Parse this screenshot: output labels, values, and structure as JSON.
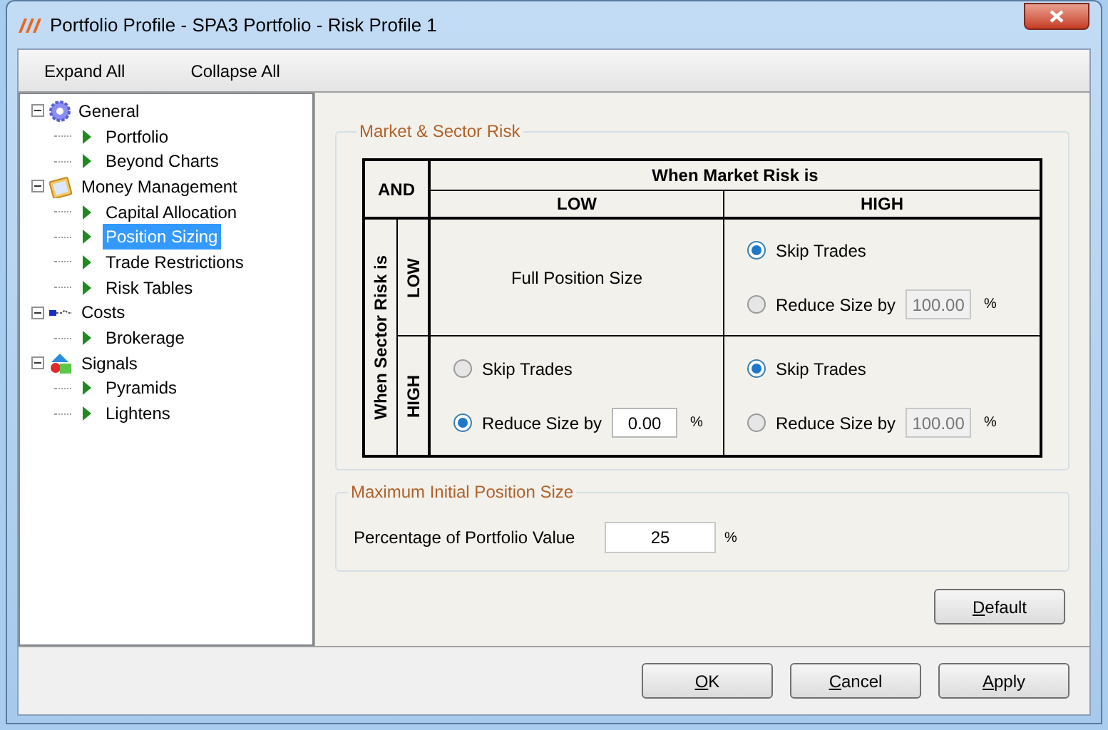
{
  "window": {
    "title": "Portfolio Profile - SPA3 Portfolio - Risk Profile 1"
  },
  "toolbar": [
    {
      "label": "Expand All"
    },
    {
      "label": "Collapse All"
    }
  ],
  "tree": [
    {
      "label": "General",
      "kind": "gear",
      "expanded": true,
      "selected": false,
      "children": [
        {
          "label": "Portfolio",
          "selected": false
        },
        {
          "label": "Beyond Charts",
          "selected": false
        }
      ]
    },
    {
      "label": "Money Management",
      "kind": "clipboard",
      "expanded": true,
      "selected": false,
      "children": [
        {
          "label": "Capital Allocation",
          "selected": false
        },
        {
          "label": "Position Sizing",
          "selected": true
        },
        {
          "label": "Trade Restrictions",
          "selected": false
        },
        {
          "label": "Risk Tables",
          "selected": false
        }
      ]
    },
    {
      "label": "Costs",
      "kind": "connector",
      "expanded": true,
      "selected": false,
      "children": [
        {
          "label": "Brokerage",
          "selected": false
        }
      ]
    },
    {
      "label": "Signals",
      "kind": "shapes",
      "expanded": true,
      "selected": false,
      "children": [
        {
          "label": "Pyramids",
          "selected": false
        },
        {
          "label": "Lightens",
          "selected": false
        }
      ]
    }
  ],
  "market_sector_risk": {
    "title": "Market & Sector Risk",
    "corner": "AND",
    "column_header": "When Market Risk is",
    "columns": [
      "LOW",
      "HIGH"
    ],
    "row_header": "When Sector Risk is",
    "rows": [
      {
        "label": "LOW",
        "cells": [
          {
            "kind": "text",
            "text": "Full Position Size"
          },
          {
            "kind": "options",
            "options": [
              {
                "label": "Skip Trades",
                "selected": true
              },
              {
                "label": "Reduce Size by",
                "selected": false,
                "value": "100.00",
                "disabled": true,
                "unit": "%"
              }
            ]
          }
        ]
      },
      {
        "label": "HIGH",
        "cells": [
          {
            "kind": "options",
            "options": [
              {
                "label": "Skip Trades",
                "selected": false
              },
              {
                "label": "Reduce Size by",
                "selected": true,
                "value": "0.00",
                "disabled": false,
                "unit": "%"
              }
            ]
          },
          {
            "kind": "options",
            "options": [
              {
                "label": "Skip Trades",
                "selected": true
              },
              {
                "label": "Reduce Size by",
                "selected": false,
                "value": "100.00",
                "disabled": true,
                "unit": "%"
              }
            ]
          }
        ]
      }
    ]
  },
  "max_initial_position_size": {
    "title": "Maximum Initial Position Size",
    "label": "Percentage of Portfolio Value",
    "value": "25",
    "unit": "%"
  },
  "default_button": "Default",
  "buttons": [
    "OK",
    "Cancel",
    "Apply"
  ]
}
